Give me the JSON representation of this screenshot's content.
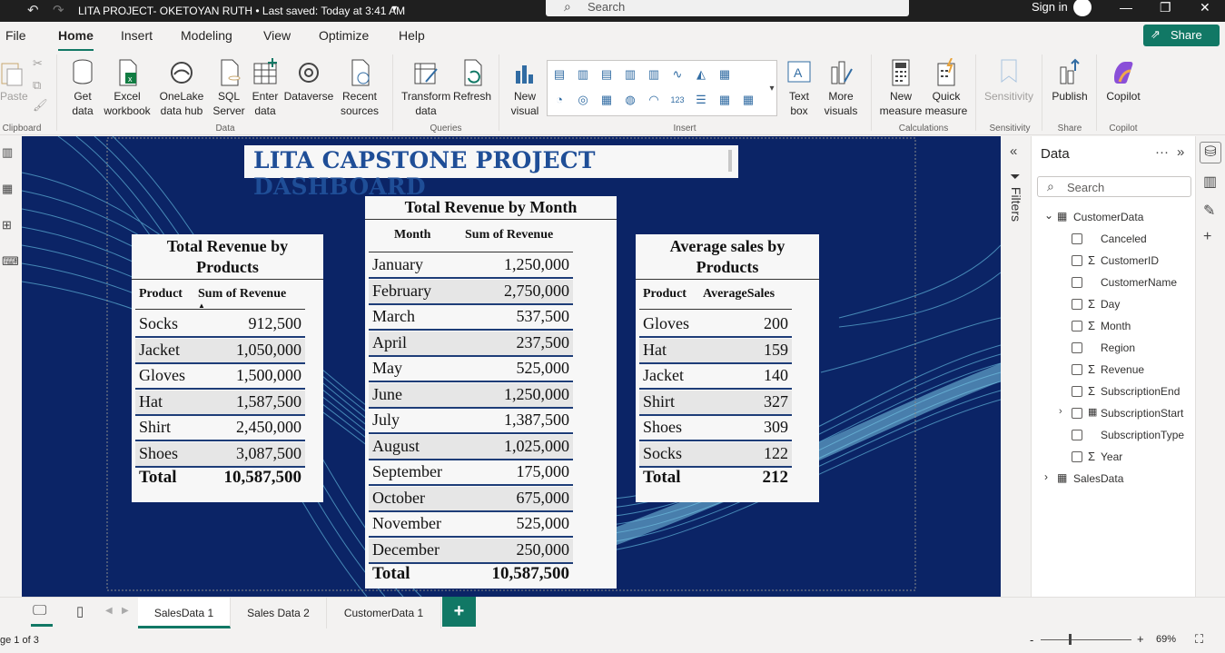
{
  "titlebar": {
    "title": "LITA PROJECT- OKETOYAN RUTH  •  Last saved: Today at 3:41 AM",
    "search": "Search",
    "signin": "Sign in"
  },
  "menu": [
    "File",
    "Home",
    "Insert",
    "Modeling",
    "View",
    "Optimize",
    "Help"
  ],
  "share_label": "Share",
  "ribbon": {
    "paste": "Paste",
    "get_data": "Get data",
    "excel": "Excel workbook",
    "onelake": "OneLake data hub",
    "sql": "SQL Server",
    "enter_data": "Enter data",
    "dataverse": "Dataverse",
    "recent": "Recent sources",
    "transform": "Transform data",
    "refresh": "Refresh",
    "new_visual": "New visual",
    "text_box": "Text box",
    "more_visuals": "More visuals",
    "new_measure": "New measure",
    "quick_measure": "Quick measure",
    "sensitivity": "Sensitivity",
    "publish": "Publish",
    "copilot": "Copilot",
    "groups": {
      "clipboard": "Clipboard",
      "data": "Data",
      "queries": "Queries",
      "insert": "Insert",
      "calculations": "Calculations",
      "sensitivity": "Sensitivity",
      "share": "Share",
      "copilot": "Copilot"
    }
  },
  "dashboard_title": "LITA CAPSTONE PROJECT DASHBOARD",
  "card_products": {
    "title_l1": "Total Revenue by",
    "title_l2": "Products",
    "h1": "Product",
    "h2": "Sum of Revenue",
    "rows": [
      [
        "Socks",
        "912,500"
      ],
      [
        "Jacket",
        "1,050,000"
      ],
      [
        "Gloves",
        "1,500,000"
      ],
      [
        "Hat",
        "1,587,500"
      ],
      [
        "Shirt",
        "2,450,000"
      ],
      [
        "Shoes",
        "3,087,500"
      ]
    ],
    "total": [
      "Total",
      "10,587,500"
    ]
  },
  "card_month": {
    "title": "Total Revenue by Month",
    "h1": "Month",
    "h2": "Sum of Revenue",
    "rows": [
      [
        "January",
        "1,250,000"
      ],
      [
        "February",
        "2,750,000"
      ],
      [
        "March",
        "537,500"
      ],
      [
        "April",
        "237,500"
      ],
      [
        "May",
        "525,000"
      ],
      [
        "June",
        "1,250,000"
      ],
      [
        "July",
        "1,387,500"
      ],
      [
        "August",
        "1,025,000"
      ],
      [
        "September",
        "175,000"
      ],
      [
        "October",
        "675,000"
      ],
      [
        "November",
        "525,000"
      ],
      [
        "December",
        "250,000"
      ]
    ],
    "total": [
      "Total",
      "10,587,500"
    ]
  },
  "card_avg": {
    "title_l1": "Average sales by",
    "title_l2": "Products",
    "h1": "Product",
    "h2": "AverageSales",
    "rows": [
      [
        "Gloves",
        "200"
      ],
      [
        "Hat",
        "159"
      ],
      [
        "Jacket",
        "140"
      ],
      [
        "Shirt",
        "327"
      ],
      [
        "Shoes",
        "309"
      ],
      [
        "Socks",
        "122"
      ]
    ],
    "total": [
      "Total",
      "212"
    ]
  },
  "filters_label": "Filters",
  "datapane": {
    "title": "Data",
    "search": "Search",
    "table1": "CustomerData",
    "fields": [
      {
        "name": "Canceled",
        "sigma": ""
      },
      {
        "name": "CustomerID",
        "sigma": "Σ"
      },
      {
        "name": "CustomerName",
        "sigma": ""
      },
      {
        "name": "Day",
        "sigma": "Σ"
      },
      {
        "name": "Month",
        "sigma": "Σ"
      },
      {
        "name": "Region",
        "sigma": ""
      },
      {
        "name": "Revenue",
        "sigma": "Σ"
      },
      {
        "name": "SubscriptionEnd",
        "sigma": "Σ"
      },
      {
        "name": "SubscriptionStart",
        "sigma": "▦"
      },
      {
        "name": "SubscriptionType",
        "sigma": ""
      },
      {
        "name": "Year",
        "sigma": "Σ"
      }
    ],
    "table2": "SalesData"
  },
  "pages": [
    "SalesData 1",
    "Sales Data 2",
    "CustomerData 1"
  ],
  "add_page": "+",
  "status": {
    "page": "ge 1 of 3",
    "zoom": "69%"
  },
  "colors": {
    "accent": "#117865",
    "canvas": "#0b2466",
    "title": "#1f4e97"
  }
}
